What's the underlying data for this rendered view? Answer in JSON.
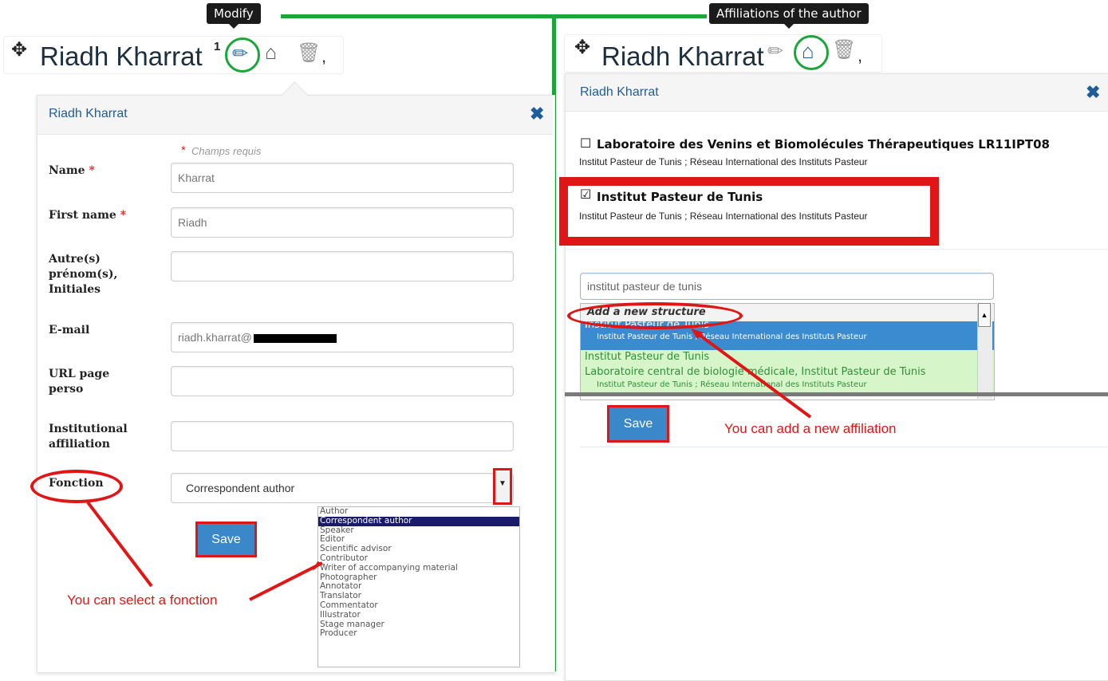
{
  "tooltips": {
    "modify": "Modify",
    "affiliations": "Affiliations of the author"
  },
  "author": {
    "name": "Riadh Kharrat",
    "superscript": "1",
    "comma": ","
  },
  "left_panel": {
    "title": "Riadh Kharrat",
    "close": "✖",
    "required_note": "Champs requis",
    "required_star": "*",
    "fields": {
      "name": {
        "label": "Name",
        "value": "Kharrat"
      },
      "first_name": {
        "label": "First name",
        "value": "Riadh"
      },
      "other_names": {
        "label": "Autre(s) prénom(s), Initiales",
        "value": ""
      },
      "email": {
        "label": "E-mail",
        "value": "riadh.kharrat@"
      },
      "url": {
        "label": "URL page perso",
        "value": ""
      },
      "affiliation": {
        "label": "Institutional affiliation",
        "value": ""
      },
      "fonction": {
        "label": "Fonction",
        "value": "Correspondent author"
      }
    },
    "save_label": "Save",
    "fonction_options": [
      "Author",
      "Correspondent author",
      "Speaker",
      "Editor",
      "Scientific advisor",
      "Contributor",
      "Writer of accompanying material",
      "Photographer",
      "Annotator",
      "Translator",
      "Commentator",
      "Illustrator",
      "Stage manager",
      "Producer"
    ],
    "selected_option_index": 1
  },
  "right_panel": {
    "title": "Riadh Kharrat",
    "close": "✖",
    "affiliations": [
      {
        "checked": false,
        "title": "Laboratoire des Venins et Biomolécules Thérapeutiques LR11IPT08",
        "sub": "Institut Pasteur de Tunis ; Réseau International des Instituts Pasteur"
      },
      {
        "checked": true,
        "title": "Institut Pasteur de Tunis",
        "sub": "Institut Pasteur de Tunis ; Réseau International des Instituts Pasteur"
      }
    ],
    "search_value": "institut pasteur de tunis",
    "dropdown": {
      "header": "Add a new structure",
      "items": [
        {
          "title": "Institut Pasteur de Tunis",
          "sub": "Institut Pasteur de Tunis ; Réseau International des Instituts Pasteur",
          "highlighted": true
        },
        {
          "title": "Institut Pasteur de Tunis",
          "sub": "",
          "highlighted": false
        },
        {
          "title": "Laboratoire central de biologie médicale, Institut Pasteur de Tunis",
          "sub": "Institut Pasteur de Tunis ; Réseau International des Instituts Pasteur",
          "highlighted": false
        }
      ]
    },
    "save_label": "Save"
  },
  "annotations": {
    "select_fonction": "You can select a fonction",
    "add_affiliation": "You can add a new affiliation"
  },
  "colors": {
    "accent": "#3a87c9",
    "annotation": "#e01515",
    "connector": "#1aa63a",
    "title_blue": "#1f5d99"
  }
}
